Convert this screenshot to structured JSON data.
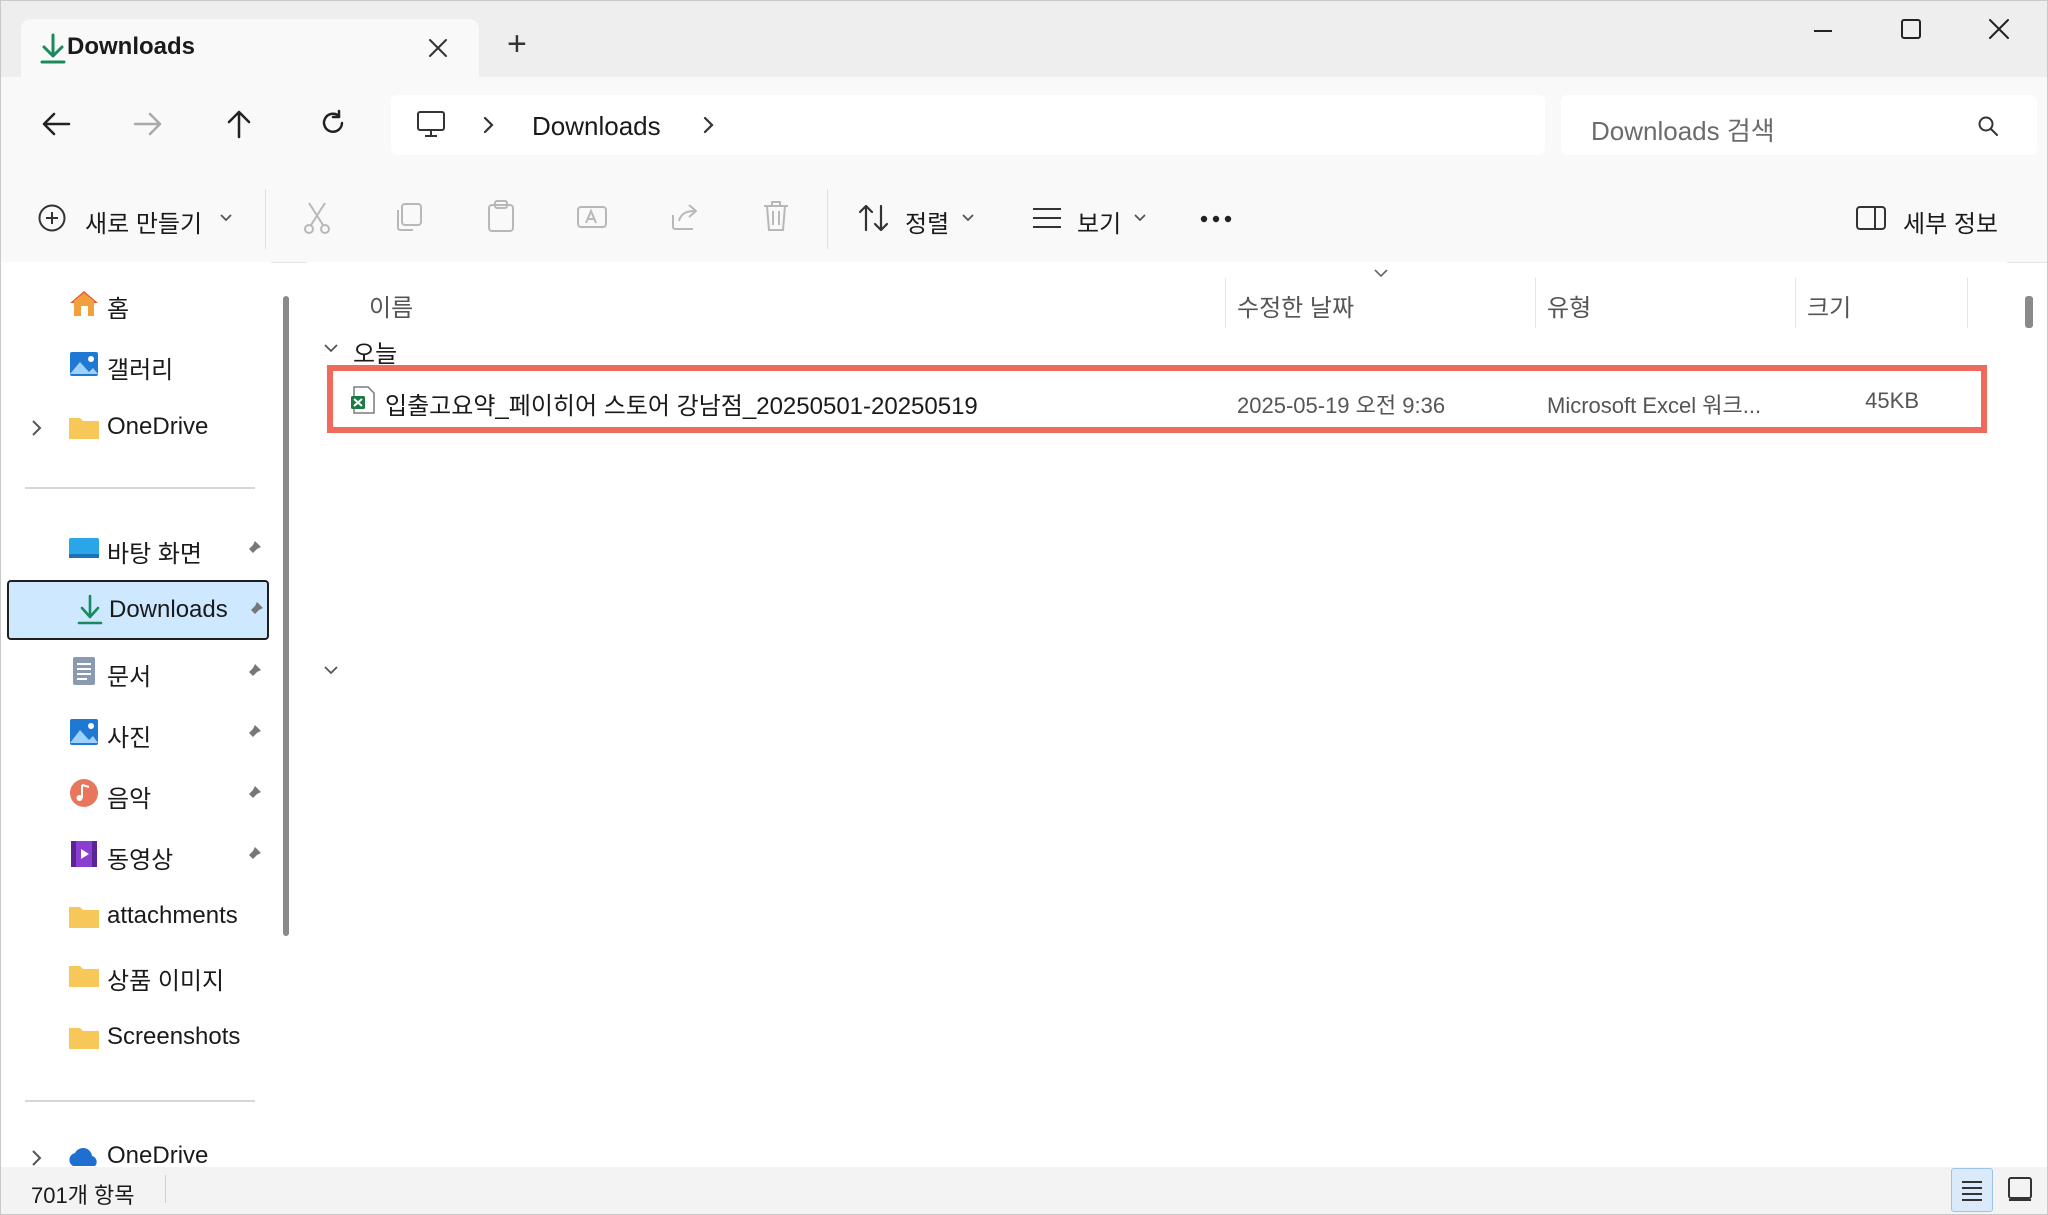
{
  "tab": {
    "title": "Downloads",
    "new_tab": "+"
  },
  "window_controls": {
    "minimize": "—",
    "maximize": "☐",
    "close": "✕"
  },
  "address": {
    "segments": [
      "Downloads"
    ]
  },
  "search": {
    "placeholder": "Downloads 검색"
  },
  "toolbar": {
    "new_label": "새로 만들기",
    "sort_label": "정렬",
    "view_label": "보기",
    "details_label": "세부 정보"
  },
  "sidebar": {
    "items": [
      {
        "label": "홈",
        "icon": "home-icon"
      },
      {
        "label": "갤러리",
        "icon": "gallery-icon"
      },
      {
        "label": "OneDrive",
        "icon": "folder-icon"
      }
    ],
    "pinned": [
      {
        "label": "바탕 화면",
        "icon": "desktop-icon",
        "pinned": true
      },
      {
        "label": "Downloads",
        "icon": "download-icon",
        "pinned": true,
        "selected": true
      },
      {
        "label": "문서",
        "icon": "document-icon",
        "pinned": true
      },
      {
        "label": "사진",
        "icon": "pictures-icon",
        "pinned": true
      },
      {
        "label": "음악",
        "icon": "music-icon",
        "pinned": true
      },
      {
        "label": "동영상",
        "icon": "video-icon",
        "pinned": true
      },
      {
        "label": "attachments",
        "icon": "folder-icon",
        "pinned": false
      },
      {
        "label": "상품 이미지",
        "icon": "folder-icon",
        "pinned": false
      },
      {
        "label": "Screenshots",
        "icon": "folder-icon",
        "pinned": false
      }
    ],
    "bottom": {
      "label": "OneDrive",
      "icon": "onedrive-cloud-icon"
    }
  },
  "columns": {
    "name": "이름",
    "date": "수정한 날짜",
    "type": "유형",
    "size": "크기"
  },
  "groups": [
    {
      "label": "오늘",
      "files": [
        {
          "name": "입출고요약_페이히어 스토어 강남점_20250501-20250519",
          "date": "2025-05-19 오전 9:36",
          "type": "Microsoft Excel 워크...",
          "size": "45KB",
          "icon": "excel-file-icon",
          "highlighted": true
        }
      ]
    }
  ],
  "status": {
    "item_count": "701개 항목"
  },
  "colors": {
    "highlight": "#f06a5c",
    "selected_bg": "#cde8ff",
    "accent": "#0a7a5a"
  }
}
